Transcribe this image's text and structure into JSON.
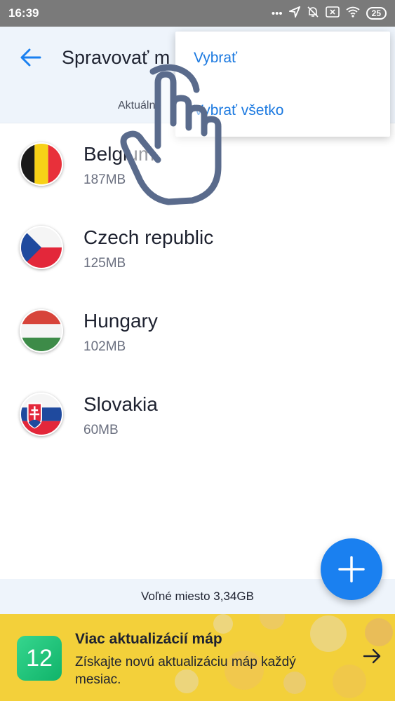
{
  "status_bar": {
    "time": "16:39",
    "battery": "25",
    "icons": [
      "more-dots-icon",
      "location-arrow-icon",
      "bell-off-icon",
      "sim-x-icon",
      "wifi-icon",
      "battery-icon"
    ]
  },
  "app_bar": {
    "title": "Spravovať m",
    "back_icon": "arrow-left-icon"
  },
  "tabs": {
    "active_label": "Aktuálne"
  },
  "maps": [
    {
      "name": "Belgium",
      "size": "187MB",
      "flag": "belgium-flag"
    },
    {
      "name": "Czech republic",
      "size": "125MB",
      "flag": "czech-flag"
    },
    {
      "name": "Hungary",
      "size": "102MB",
      "flag": "hungary-flag"
    },
    {
      "name": "Slovakia",
      "size": "60MB",
      "flag": "slovakia-flag"
    }
  ],
  "free_space": "Voľné miesto 3,34GB",
  "banner": {
    "badge": "12",
    "title": "Viac aktualizácií máp",
    "text": "Získajte novú aktualizáciu máp každý mesiac."
  },
  "menu": {
    "items": [
      "Vybrať",
      "Vybrať všetko"
    ]
  },
  "colors": {
    "accent": "#1a80f0",
    "app_bar_bg": "#eef4fb",
    "banner_bg": "#f3d03a",
    "status_bar_bg": "#7a7a7a"
  }
}
